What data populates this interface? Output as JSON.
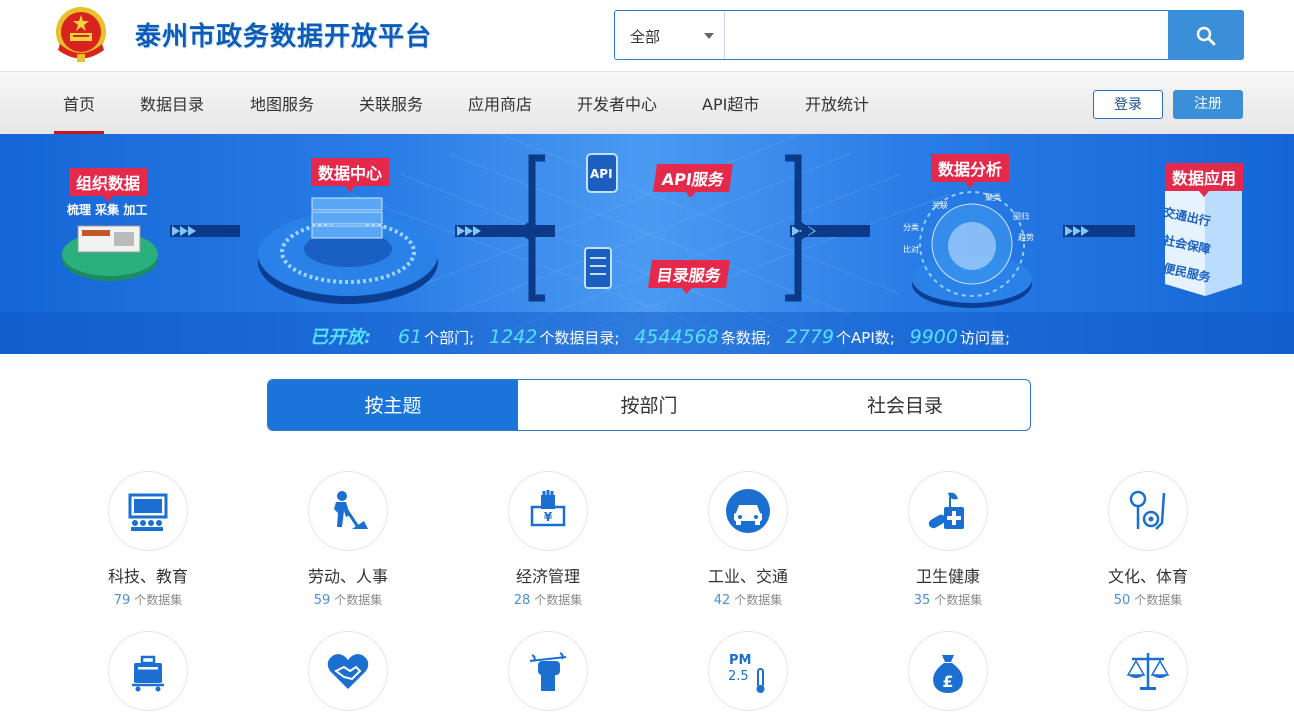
{
  "header": {
    "site_title": "泰州市政务数据开放平台",
    "search": {
      "scope_selected": "全部",
      "placeholder": "",
      "value": ""
    }
  },
  "nav": {
    "items": [
      "首页",
      "数据目录",
      "地图服务",
      "关联服务",
      "应用商店",
      "开发者中心",
      "API超市",
      "开放统计"
    ],
    "active_index": 0,
    "login_label": "登录",
    "register_label": "注册"
  },
  "banner": {
    "tags": {
      "organize": "组织数据",
      "organize_sub": "梳理 采集 加工",
      "data_center": "数据中心",
      "api_service": "API服务",
      "catalog_service": "目录服务",
      "analysis": "数据分析",
      "application": "数据应用"
    },
    "api_icon_text": "API",
    "analysis_words": [
      "聚类",
      "关联",
      "回归",
      "分类",
      "趋势",
      "比对"
    ],
    "application_items": [
      "交通出行",
      "社会保障",
      "便民服务"
    ],
    "stats": {
      "prefix": "已开放:",
      "items": [
        {
          "value": "61",
          "unit": "个部门;"
        },
        {
          "value": "1242",
          "unit": "个数据目录;"
        },
        {
          "value": "4544568",
          "unit": "条数据;"
        },
        {
          "value": "2779",
          "unit": "个API数;"
        },
        {
          "value": "9900",
          "unit": "访问量;"
        }
      ]
    }
  },
  "tabs": {
    "items": [
      "按主题",
      "按部门",
      "社会目录"
    ],
    "active_index": 0
  },
  "categories": [
    {
      "name": "科技、教育",
      "count": "79",
      "unit": "个数据集",
      "icon": "classroom-icon"
    },
    {
      "name": "劳动、人事",
      "count": "59",
      "unit": "个数据集",
      "icon": "worker-icon"
    },
    {
      "name": "经济管理",
      "count": "28",
      "unit": "个数据集",
      "icon": "money-hand-icon"
    },
    {
      "name": "工业、交通",
      "count": "42",
      "unit": "个数据集",
      "icon": "car-icon"
    },
    {
      "name": "卫生健康",
      "count": "35",
      "unit": "个数据集",
      "icon": "medicine-icon"
    },
    {
      "name": "文化、体育",
      "count": "50",
      "unit": "个数据集",
      "icon": "sports-icon"
    }
  ],
  "categories_row2_icons": [
    "luggage-cart-icon",
    "heart-handshake-icon",
    "fist-branch-icon",
    "pm25-thermometer-icon",
    "pound-bag-icon",
    "scales-icon"
  ],
  "pm_icon_text": [
    "PM",
    "2.5"
  ],
  "colors": {
    "brand": "#1a74d9",
    "accent_red": "#e5294a",
    "stat_cyan": "#55e0ff"
  }
}
